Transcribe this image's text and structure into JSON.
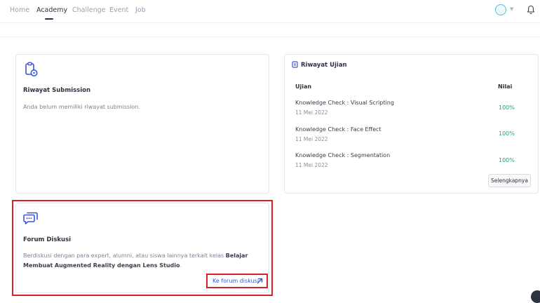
{
  "nav": {
    "items": [
      {
        "label": "Home"
      },
      {
        "label": "Academy"
      },
      {
        "label": "Challenge"
      },
      {
        "label": "Event"
      },
      {
        "label": "Job"
      }
    ],
    "active": "Academy"
  },
  "submission": {
    "title": "Riwayat Submission",
    "empty_text": "Anda belum memiliki riwayat submission."
  },
  "exam": {
    "title": "Riwayat Ujian",
    "col_exam": "Ujian",
    "col_score": "Nilai",
    "rows": [
      {
        "name": "Knowledge Check : Visual Scripting",
        "date": "11 Mei 2022",
        "score": "100%"
      },
      {
        "name": "Knowledge Check : Face Effect",
        "date": "11 Mei 2022",
        "score": "100%"
      },
      {
        "name": "Knowledge Check : Segmentation",
        "date": "11 Mei 2022",
        "score": "100%"
      }
    ],
    "more_label": "Selengkapnya"
  },
  "forum": {
    "title": "Forum Diskusi",
    "desc_prefix": "Berdiskusi dengan para expert, alumni, atau siswa lainnya terkait kelas ",
    "desc_bold_1": "Belajar Membuat",
    "desc_bold_2": "Augmented Reality dengan Lens Studio",
    "desc_suffix": ".",
    "link_label": "Ke forum diskusi"
  },
  "colors": {
    "accent": "#3b57d6",
    "success": "#1ea86a",
    "highlight": "#d6202a"
  },
  "icons": [
    "clipboard-icon",
    "document-icon",
    "chat-icon",
    "arrow-up-right-icon",
    "bell-icon",
    "chevron-down-icon"
  ]
}
